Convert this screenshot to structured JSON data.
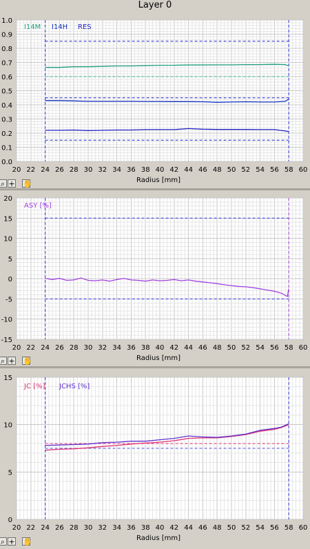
{
  "window_title": "Layer 0",
  "toolbar_icons": [
    "zoom-icon",
    "crosshair-icon",
    "hand-icon"
  ],
  "chart_data": [
    {
      "type": "line",
      "xlabel": "Radius [mm]",
      "xlim": [
        20,
        60
      ],
      "ylim": [
        0,
        1.0
      ],
      "x_ticks": [
        20,
        22,
        24,
        26,
        28,
        30,
        32,
        34,
        36,
        38,
        40,
        42,
        44,
        46,
        48,
        50,
        52,
        54,
        56,
        58,
        60
      ],
      "y_ticks": [
        0.0,
        0.1,
        0.2,
        0.3,
        0.4,
        0.5,
        0.6,
        0.7,
        0.8,
        0.9,
        1.0
      ],
      "y_tick_labels": [
        "0.0",
        "0.1",
        "0.2",
        "0.3",
        "0.4",
        "0.5",
        "0.6",
        "0.7",
        "0.8",
        "0.9",
        "1.0"
      ],
      "grid": true,
      "legend": [
        {
          "label": "I14M",
          "color": "#20a080"
        },
        {
          "label": "I14H",
          "color": "#1030c0"
        },
        {
          "label": "RES",
          "color": "#2020c0"
        }
      ],
      "vlines": [
        {
          "x": 24,
          "color": "#3030e0"
        },
        {
          "x": 58,
          "color": "#3030e0"
        }
      ],
      "hlines": [
        {
          "y": 0.85,
          "color": "#2020d0"
        },
        {
          "y": 0.6,
          "color": "#30b090"
        },
        {
          "y": 0.45,
          "color": "#2020d0"
        },
        {
          "y": 0.15,
          "color": "#2020d0"
        }
      ],
      "series": [
        {
          "name": "I14M",
          "color": "#20a080",
          "x": [
            24,
            26,
            28,
            30,
            32,
            34,
            36,
            38,
            40,
            42,
            44,
            46,
            48,
            50,
            52,
            54,
            56,
            57.5,
            58
          ],
          "y": [
            0.665,
            0.665,
            0.67,
            0.67,
            0.672,
            0.675,
            0.675,
            0.677,
            0.68,
            0.68,
            0.682,
            0.682,
            0.683,
            0.683,
            0.685,
            0.685,
            0.687,
            0.685,
            0.675
          ]
        },
        {
          "name": "I14H",
          "color": "#1030c0",
          "x": [
            24,
            26,
            28,
            30,
            32,
            34,
            36,
            38,
            40,
            42,
            44,
            46,
            48,
            50,
            52,
            54,
            56,
            57.5,
            58
          ],
          "y": [
            0.43,
            0.43,
            0.428,
            0.425,
            0.425,
            0.425,
            0.425,
            0.424,
            0.424,
            0.423,
            0.423,
            0.422,
            0.418,
            0.42,
            0.422,
            0.42,
            0.42,
            0.425,
            0.44
          ]
        },
        {
          "name": "RES",
          "color": "#2020c0",
          "x": [
            24,
            26,
            28,
            30,
            32,
            34,
            36,
            38,
            40,
            42,
            44,
            46,
            48,
            50,
            52,
            54,
            56,
            57.5,
            58
          ],
          "y": [
            0.22,
            0.22,
            0.222,
            0.218,
            0.22,
            0.222,
            0.222,
            0.225,
            0.225,
            0.225,
            0.232,
            0.228,
            0.226,
            0.226,
            0.226,
            0.225,
            0.225,
            0.215,
            0.21
          ]
        }
      ]
    },
    {
      "type": "line",
      "xlabel": "Radius [mm]",
      "xlim": [
        20,
        60
      ],
      "ylim": [
        -15,
        20
      ],
      "x_ticks": [
        20,
        22,
        24,
        26,
        28,
        30,
        32,
        34,
        36,
        38,
        40,
        42,
        44,
        46,
        48,
        50,
        52,
        54,
        56,
        58,
        60
      ],
      "y_ticks": [
        -15,
        -10,
        -5,
        0,
        5,
        10,
        15,
        20
      ],
      "y_tick_labels": [
        "-15",
        "-10",
        "-5",
        "0",
        "5",
        "10",
        "15",
        "20"
      ],
      "grid": true,
      "legend": [
        {
          "label": "ASY [%]",
          "color": "#a040e0"
        }
      ],
      "vlines": [
        {
          "x": 24,
          "color": "#3030e0"
        },
        {
          "x": 58,
          "color": "#a040e0"
        }
      ],
      "hlines": [
        {
          "y": 15,
          "color": "#3030e0"
        },
        {
          "y": -5,
          "color": "#3030e0"
        }
      ],
      "series": [
        {
          "name": "ASY [%]",
          "color": "#a040e0",
          "x": [
            24,
            25,
            26,
            27,
            28,
            29,
            30,
            31,
            32,
            33,
            34,
            35,
            36,
            37,
            38,
            39,
            40,
            41,
            42,
            43,
            44,
            45,
            46,
            47,
            48,
            49,
            50,
            51,
            52,
            53,
            54,
            55,
            56,
            57,
            57.8,
            58
          ],
          "y": [
            0.1,
            -0.2,
            0.1,
            -0.4,
            -0.3,
            0.2,
            -0.4,
            -0.5,
            -0.3,
            -0.6,
            -0.2,
            0.1,
            -0.3,
            -0.4,
            -0.6,
            -0.3,
            -0.5,
            -0.4,
            -0.2,
            -0.5,
            -0.3,
            -0.6,
            -0.8,
            -1.0,
            -1.2,
            -1.5,
            -1.7,
            -1.9,
            -2.0,
            -2.2,
            -2.5,
            -2.8,
            -3.1,
            -3.6,
            -4.4,
            -2.5
          ]
        }
      ]
    },
    {
      "type": "line",
      "xlabel": "Radius [mm]",
      "xlim": [
        20,
        60
      ],
      "ylim": [
        0,
        15
      ],
      "x_ticks": [
        20,
        22,
        24,
        26,
        28,
        30,
        32,
        34,
        36,
        38,
        40,
        42,
        44,
        46,
        48,
        50,
        52,
        54,
        56,
        58,
        60
      ],
      "y_ticks": [
        0,
        5,
        10,
        15
      ],
      "y_tick_labels": [
        "0",
        "5",
        "10",
        "15"
      ],
      "grid": true,
      "legend": [
        {
          "label": "JC [%]",
          "color": "#e03070"
        },
        {
          "label": "JCHS [%]",
          "color": "#6030d0"
        }
      ],
      "vlines": [
        {
          "x": 24,
          "color": "#3030e0"
        },
        {
          "x": 58,
          "color": "#3030e0"
        }
      ],
      "hlines": [
        {
          "y": 8.0,
          "color": "#e03070"
        },
        {
          "y": 7.5,
          "color": "#5050e0"
        }
      ],
      "series": [
        {
          "name": "JC [%]",
          "color": "#e03070",
          "x": [
            24,
            26,
            28,
            30,
            32,
            34,
            36,
            38,
            40,
            42,
            44,
            46,
            48,
            50,
            52,
            54,
            56,
            57,
            58
          ],
          "y": [
            7.3,
            7.4,
            7.45,
            7.55,
            7.7,
            7.8,
            7.95,
            8.05,
            8.15,
            8.3,
            8.55,
            8.6,
            8.6,
            8.75,
            8.95,
            9.3,
            9.5,
            9.7,
            10.0
          ]
        },
        {
          "name": "JCHS [%]",
          "color": "#6030d0",
          "x": [
            24,
            26,
            28,
            30,
            32,
            34,
            36,
            38,
            40,
            42,
            44,
            46,
            48,
            50,
            52,
            54,
            56,
            57,
            58
          ],
          "y": [
            7.8,
            7.85,
            7.9,
            7.95,
            8.1,
            8.15,
            8.25,
            8.25,
            8.4,
            8.55,
            8.8,
            8.7,
            8.65,
            8.8,
            9.0,
            9.4,
            9.6,
            9.75,
            10.1
          ]
        }
      ]
    }
  ]
}
